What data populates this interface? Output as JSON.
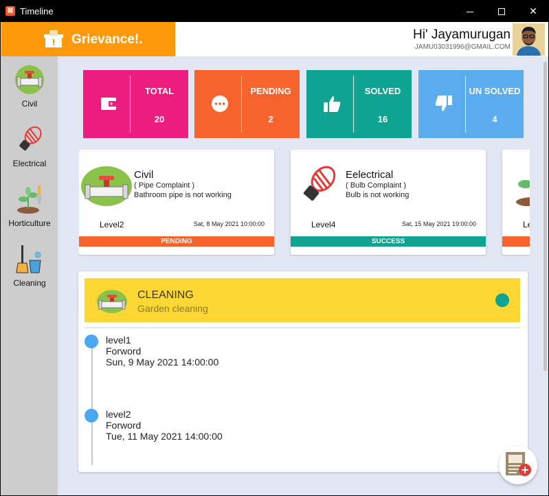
{
  "window": {
    "title": "Timeline",
    "min": "—",
    "close": "✕"
  },
  "brand": {
    "name": "Grievance!."
  },
  "user": {
    "greeting": "Hi' Jayamurugan",
    "email": "JAMU03031996@GMAIL.COM"
  },
  "sidebar": {
    "items": [
      {
        "label": "Civil",
        "icon": "pipe-icon"
      },
      {
        "label": "Electrical",
        "icon": "bulb-icon"
      },
      {
        "label": "Horticulture",
        "icon": "plant-icon"
      },
      {
        "label": "Cleaning",
        "icon": "broom-bucket-icon"
      }
    ]
  },
  "stats": [
    {
      "label": "TOTAL",
      "value": "20",
      "color": "#ec1d7e",
      "icon": "wallet-icon"
    },
    {
      "label": "PENDING",
      "value": "2",
      "color": "#f7632c",
      "icon": "more-dots-icon"
    },
    {
      "label": "SOLVED",
      "value": "16",
      "color": "#0fa391",
      "icon": "thumbs-up-icon"
    },
    {
      "label": "UN SOLVED",
      "value": "4",
      "color": "#5aacef",
      "icon": "thumbs-down-icon"
    }
  ],
  "cards": [
    {
      "title": "Civil",
      "subtitle": "( Pipe Complaint )",
      "desc": "Bathroom pipe is not working",
      "level": "Level2",
      "date": "Sat, 8 May 2021 10:00:00",
      "status": "PENDING",
      "status_color": "#f7632c"
    },
    {
      "title": "Eelectrical",
      "subtitle": "( Bulb Complaint )",
      "desc": "Bulb is not working",
      "level": "Level4",
      "date": "Sat, 15 May 2021 19:00:00",
      "status": "SUCCESS",
      "status_color": "#0fa391"
    },
    {
      "title": "",
      "subtitle": "",
      "desc": "",
      "level": "Le",
      "date": "",
      "status": "",
      "status_color": "#f7632c"
    }
  ],
  "timeline": {
    "title": "CLEANING",
    "subtitle": "Garden cleaning",
    "entries": [
      {
        "level": "level1",
        "action": "Forword",
        "date": "Sun, 9 May 2021 14:00:00"
      },
      {
        "level": "level2",
        "action": "Forword",
        "date": "Tue, 11 May 2021 14:00:00"
      }
    ]
  },
  "colors": {
    "accent": "#fd9a0b",
    "status_dot": "#10a38f",
    "timeline_dot": "#4ba8f0",
    "header_yellow": "#fdd835"
  }
}
